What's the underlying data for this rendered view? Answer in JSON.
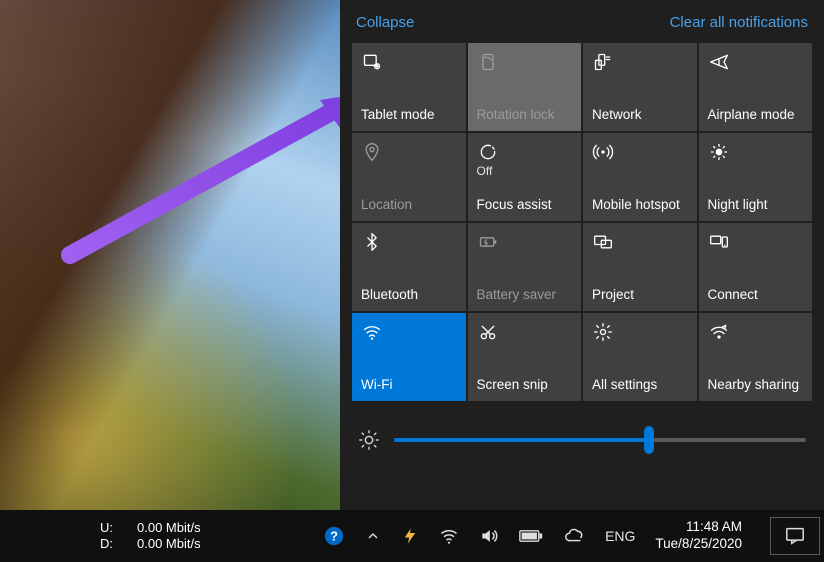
{
  "panel": {
    "collapse": "Collapse",
    "clear": "Clear all notifications",
    "brightness_percent": 62
  },
  "tiles": [
    {
      "key": "tablet",
      "label": "Tablet mode",
      "state": "",
      "icon": "tablet-icon",
      "style": "normal"
    },
    {
      "key": "rotation",
      "label": "Rotation lock",
      "state": "",
      "icon": "rotation-icon",
      "style": "highlight"
    },
    {
      "key": "network",
      "label": "Network",
      "state": "",
      "icon": "network-icon",
      "style": "normal"
    },
    {
      "key": "airplane",
      "label": "Airplane mode",
      "state": "",
      "icon": "airplane-icon",
      "style": "normal"
    },
    {
      "key": "location",
      "label": "Location",
      "state": "",
      "icon": "location-icon",
      "style": "dim"
    },
    {
      "key": "focus",
      "label": "Focus assist",
      "state": "Off",
      "icon": "focus-icon",
      "style": "normal"
    },
    {
      "key": "hotspot",
      "label": "Mobile hotspot",
      "state": "",
      "icon": "hotspot-icon",
      "style": "normal"
    },
    {
      "key": "night",
      "label": "Night light",
      "state": "",
      "icon": "night-icon",
      "style": "normal"
    },
    {
      "key": "bluetooth",
      "label": "Bluetooth",
      "state": "",
      "icon": "bluetooth-icon",
      "style": "normal"
    },
    {
      "key": "battery",
      "label": "Battery saver",
      "state": "",
      "icon": "battery-icon",
      "style": "dim"
    },
    {
      "key": "project",
      "label": "Project",
      "state": "",
      "icon": "project-icon",
      "style": "normal"
    },
    {
      "key": "connect",
      "label": "Connect",
      "state": "",
      "icon": "connect-icon",
      "style": "normal"
    },
    {
      "key": "wifi",
      "label": "Wi-Fi",
      "state": "",
      "icon": "wifi-icon",
      "style": "active"
    },
    {
      "key": "snip",
      "label": "Screen snip",
      "state": "",
      "icon": "snip-icon",
      "style": "normal"
    },
    {
      "key": "settings",
      "label": "All settings",
      "state": "",
      "icon": "settings-icon",
      "style": "normal"
    },
    {
      "key": "sharing",
      "label": "Nearby sharing",
      "state": "",
      "icon": "sharing-icon",
      "style": "normal"
    }
  ],
  "taskbar": {
    "net_u_label": "U:",
    "net_d_label": "D:",
    "net_u_value": "0.00 Mbit/s",
    "net_d_value": "0.00 Mbit/s",
    "lang": "ENG",
    "time": "11:48 AM",
    "date": "Tue/8/25/2020"
  },
  "colors": {
    "accent": "#0078d7",
    "link": "#4aa0e6",
    "tile_bg": "#404040",
    "panel_bg": "#1f1f1f"
  }
}
